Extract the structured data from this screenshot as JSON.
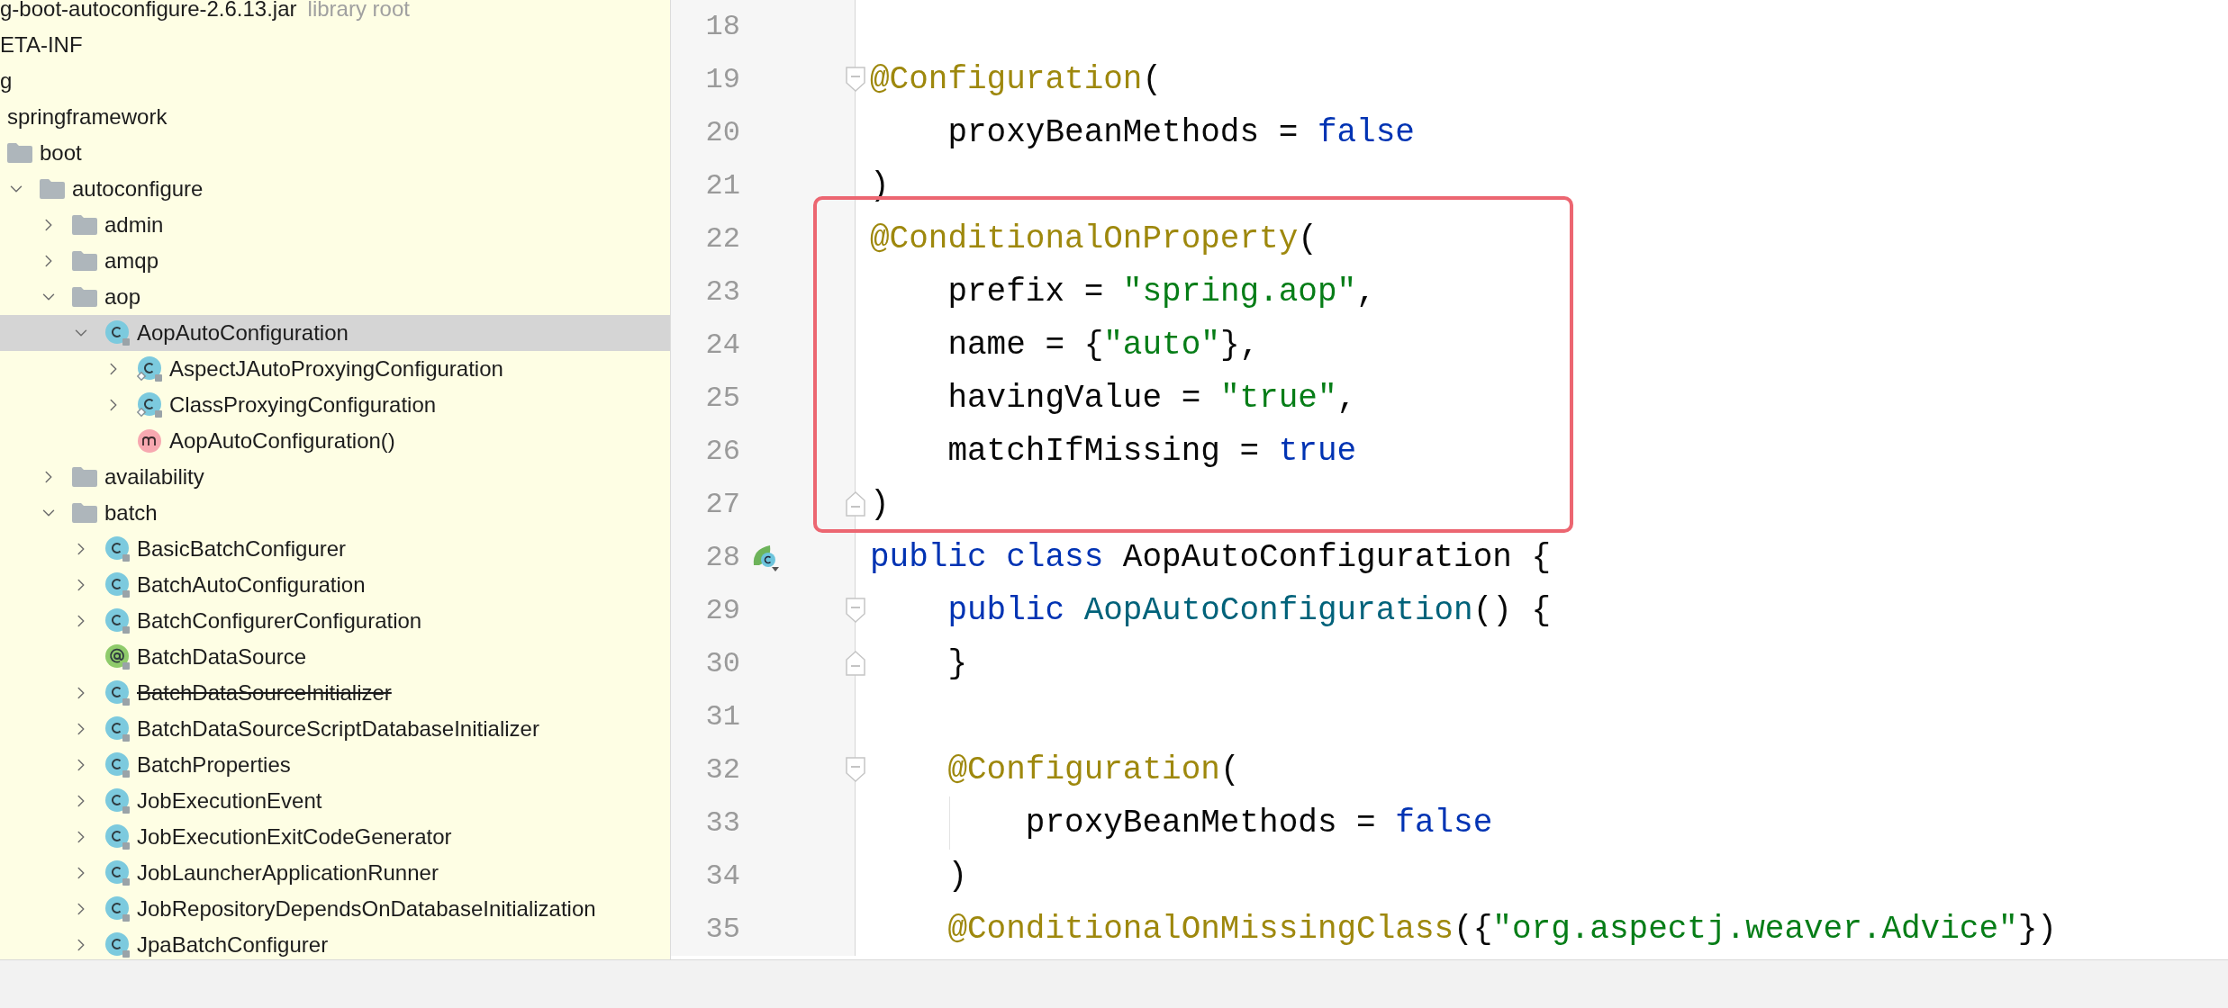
{
  "project_tree": {
    "root": {
      "label": "g-boot-autoconfigure-2.6.13.jar",
      "note": "library root",
      "selected": false,
      "children": [
        {
          "label": "ETA-INF",
          "selected": false
        },
        {
          "label": "g",
          "selected": false,
          "children": [
            {
              "label": "springframework",
              "selected": false,
              "children": [
                {
                  "label": "boot",
                  "kind": "folder",
                  "selected": false,
                  "children": [
                    {
                      "label": "autoconfigure",
                      "kind": "folder",
                      "expanded": true,
                      "selected": false,
                      "children": [
                        {
                          "label": "admin",
                          "kind": "folder",
                          "expanded": false,
                          "selected": false
                        },
                        {
                          "label": "amqp",
                          "kind": "folder",
                          "expanded": false,
                          "selected": false
                        },
                        {
                          "label": "aop",
                          "kind": "folder",
                          "expanded": true,
                          "selected": false,
                          "children": [
                            {
                              "label": "AopAutoConfiguration",
                              "kind": "class",
                              "expanded": true,
                              "selected": true,
                              "children": [
                                {
                                  "label": "AspectJAutoProxyingConfiguration",
                                  "kind": "inner_class",
                                  "expanded": false,
                                  "selected": false
                                },
                                {
                                  "label": "ClassProxyingConfiguration",
                                  "kind": "inner_class",
                                  "expanded": false,
                                  "selected": false
                                },
                                {
                                  "label": "AopAutoConfiguration()",
                                  "kind": "method",
                                  "selected": false
                                }
                              ]
                            }
                          ]
                        },
                        {
                          "label": "availability",
                          "kind": "folder",
                          "expanded": false,
                          "selected": false
                        },
                        {
                          "label": "batch",
                          "kind": "folder",
                          "expanded": true,
                          "selected": false,
                          "children": [
                            {
                              "label": "BasicBatchConfigurer",
                              "kind": "class",
                              "expanded": false,
                              "selected": false,
                              "deprecated": false
                            },
                            {
                              "label": "BatchAutoConfiguration",
                              "kind": "class",
                              "expanded": false,
                              "selected": false,
                              "deprecated": false
                            },
                            {
                              "label": "BatchConfigurerConfiguration",
                              "kind": "class",
                              "expanded": false,
                              "selected": false,
                              "deprecated": false
                            },
                            {
                              "label": "BatchDataSource",
                              "kind": "annotation",
                              "selected": false,
                              "deprecated": false
                            },
                            {
                              "label": "BatchDataSourceInitializer",
                              "kind": "class",
                              "expanded": false,
                              "selected": false,
                              "deprecated": true
                            },
                            {
                              "label": "BatchDataSourceScriptDatabaseInitializer",
                              "kind": "class",
                              "expanded": false,
                              "selected": false,
                              "deprecated": false
                            },
                            {
                              "label": "BatchProperties",
                              "kind": "class",
                              "expanded": false,
                              "selected": false,
                              "deprecated": false
                            },
                            {
                              "label": "JobExecutionEvent",
                              "kind": "class",
                              "expanded": false,
                              "selected": false,
                              "deprecated": false
                            },
                            {
                              "label": "JobExecutionExitCodeGenerator",
                              "kind": "class",
                              "expanded": false,
                              "selected": false,
                              "deprecated": false
                            },
                            {
                              "label": "JobLauncherApplicationRunner",
                              "kind": "class",
                              "expanded": false,
                              "selected": false,
                              "deprecated": false
                            },
                            {
                              "label": "JobRepositoryDependsOnDatabaseInitialization",
                              "kind": "class",
                              "expanded": false,
                              "selected": false,
                              "deprecated": false
                            },
                            {
                              "label": "JpaBatchConfigurer",
                              "kind": "class",
                              "expanded": false,
                              "selected": false,
                              "deprecated": false
                            }
                          ]
                        }
                      ]
                    }
                  ]
                }
              ]
            }
          ]
        }
      ]
    }
  },
  "editor": {
    "lines_before": [
      {
        "number": "18",
        "kind": "plain"
      },
      {
        "number": "19",
        "kind": "fold_start",
        "tokens": [
          {
            "text": "@Configuration",
            "kind": "annotation"
          },
          {
            "text": "(",
            "kind": "plain"
          }
        ]
      },
      {
        "number": "20",
        "kind": "plain",
        "tokens": [
          {
            "text": "    proxyBeanMethods = ",
            "kind": "plain"
          },
          {
            "text": "false",
            "kind": "keyword"
          }
        ]
      },
      {
        "number": "21",
        "kind": "plain",
        "tokens": [
          {
            "text": ")",
            "kind": "plain"
          }
        ]
      }
    ],
    "highlighted_lines": [
      {
        "number": "22",
        "kind": "plain",
        "tokens": [
          {
            "text": "@ConditionalOnProperty",
            "kind": "annotation"
          },
          {
            "text": "(",
            "kind": "plain"
          }
        ]
      },
      {
        "number": "23",
        "kind": "plain",
        "tokens": [
          {
            "text": "    prefix = ",
            "kind": "plain"
          },
          {
            "text": "\"spring.aop\"",
            "kind": "string"
          },
          {
            "text": ",",
            "kind": "plain"
          }
        ]
      },
      {
        "number": "24",
        "kind": "plain",
        "tokens": [
          {
            "text": "    name = {",
            "kind": "plain"
          },
          {
            "text": "\"auto\"",
            "kind": "string"
          },
          {
            "text": "},",
            "kind": "plain"
          }
        ]
      },
      {
        "number": "25",
        "kind": "plain",
        "tokens": [
          {
            "text": "    havingValue = ",
            "kind": "plain"
          },
          {
            "text": "\"true\"",
            "kind": "string"
          },
          {
            "text": ",",
            "kind": "plain"
          }
        ]
      },
      {
        "number": "26",
        "kind": "plain",
        "tokens": [
          {
            "text": "    matchIfMissing = ",
            "kind": "plain"
          },
          {
            "text": "true",
            "kind": "keyword"
          }
        ]
      },
      {
        "number": "27",
        "kind": "fold_end",
        "tokens": [
          {
            "text": ")",
            "kind": "plain"
          }
        ]
      }
    ],
    "lines_after": [
      {
        "number": "28",
        "kind": "bean",
        "tokens": [
          {
            "text": "public class ",
            "kind": "keyword"
          },
          {
            "text": "AopAutoConfiguration {",
            "kind": "plain"
          }
        ]
      },
      {
        "number": "29",
        "kind": "fold_start",
        "tokens": [
          {
            "text": "    public ",
            "kind": "keyword"
          },
          {
            "text": "AopAutoConfiguration",
            "kind": "method"
          },
          {
            "text": "() {",
            "kind": "plain"
          }
        ]
      },
      {
        "number": "30",
        "kind": "fold_end",
        "tokens": [
          {
            "text": "    }",
            "kind": "plain"
          }
        ]
      },
      {
        "number": "31",
        "kind": "plain"
      },
      {
        "number": "32",
        "kind": "fold_start",
        "tokens": [
          {
            "text": "    @Configuration",
            "kind": "annotation"
          },
          {
            "text": "(",
            "kind": "plain"
          }
        ]
      },
      {
        "number": "33",
        "kind": "guide",
        "tokens": [
          {
            "text": "        proxyBeanMethods = ",
            "kind": "plain"
          },
          {
            "text": "false",
            "kind": "keyword"
          }
        ]
      },
      {
        "number": "34",
        "kind": "plain",
        "tokens": [
          {
            "text": "    )",
            "kind": "plain"
          }
        ]
      },
      {
        "number": "35",
        "kind": "plain",
        "tokens": [
          {
            "text": "    @ConditionalOnMissingClass",
            "kind": "annotation"
          },
          {
            "text": "({",
            "kind": "plain"
          },
          {
            "text": "\"org.aspectj.weaver.Advice\"",
            "kind": "string"
          },
          {
            "text": "})",
            "kind": "plain"
          }
        ]
      }
    ]
  }
}
